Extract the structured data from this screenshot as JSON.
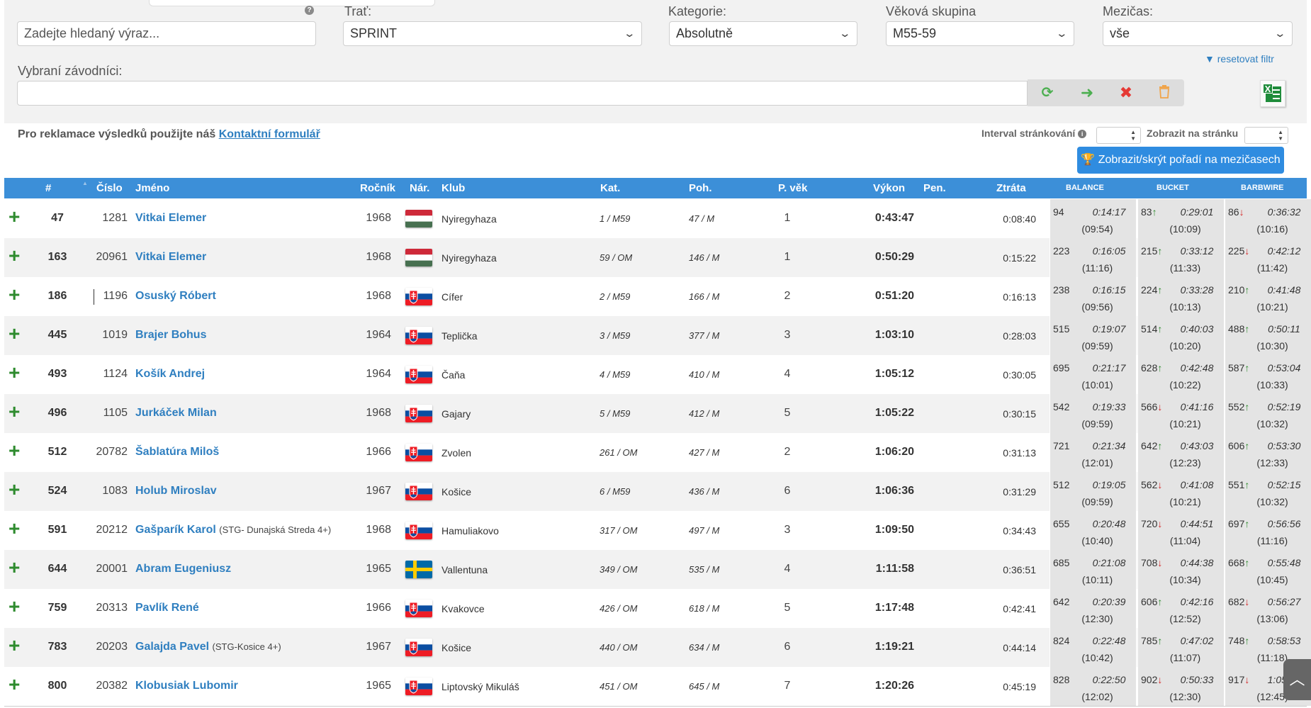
{
  "filters": {
    "search_placeholder": "Zadejte hledaný výraz...",
    "trat": {
      "label": "Trať:",
      "value": "SPRINT"
    },
    "kategorie": {
      "label": "Kategorie:",
      "value": "Absolutně"
    },
    "vekova": {
      "label": "Věková skupina",
      "value": "M55-59"
    },
    "mezicas": {
      "label": "Mezičas:",
      "value": "vše"
    },
    "reset": "resetovat filtr",
    "selected_label": "Vybraní závodníci:"
  },
  "info": {
    "text": "Pro reklamace výsledků použijte náš",
    "link": "Kontaktní formulář",
    "interval": "Interval stránkování",
    "per_page": "Zobrazit na stránku",
    "toggle_button": "Zobrazit/skrýt pořadí na mezičasech"
  },
  "headers": {
    "rank": "#",
    "num": "Číslo",
    "name": "Jméno",
    "year": "Ročník",
    "nat": "Nár.",
    "club": "Klub",
    "kat": "Kat.",
    "poh": "Poh.",
    "pvek": "P. věk",
    "vykon": "Výkon",
    "pen": "Pen.",
    "ztrata": "Ztráta",
    "s1": "BALANCE",
    "s2": "BUCKET",
    "s3": "BARBWIRE"
  },
  "colors": {
    "header_bg": "#3c8fd8",
    "link": "#2f7fc0",
    "up": "#2e8b2e",
    "down": "#d42a2a"
  },
  "rows": [
    {
      "rank": "47",
      "num": "1281",
      "name": "Vitkai Elemer",
      "team": "",
      "year": "1968",
      "flag": "hu",
      "club": "Nyiregyhaza",
      "kat": "1 / M59",
      "poh": "47 / M",
      "pvek": "1",
      "vykon": "0:43:47",
      "ztrata": "0:08:40",
      "s": [
        {
          "r": "94",
          "d": "",
          "t": "0:14:17",
          "sub": "(09:54)"
        },
        {
          "r": "83",
          "d": "up",
          "t": "0:29:01",
          "sub": "(10:09)"
        },
        {
          "r": "86",
          "d": "down",
          "t": "0:36:32",
          "sub": "(10:16)"
        }
      ]
    },
    {
      "rank": "163",
      "num": "20961",
      "name": "Vitkai Elemer",
      "team": "",
      "year": "1968",
      "flag": "hu",
      "club": "Nyiregyhaza",
      "kat": "59 / OM",
      "poh": "146 / M",
      "pvek": "1",
      "vykon": "0:50:29",
      "ztrata": "0:15:22",
      "s": [
        {
          "r": "223",
          "d": "",
          "t": "0:16:05",
          "sub": "(11:16)"
        },
        {
          "r": "215",
          "d": "up",
          "t": "0:33:12",
          "sub": "(11:33)"
        },
        {
          "r": "225",
          "d": "down",
          "t": "0:42:12",
          "sub": "(11:42)"
        }
      ]
    },
    {
      "rank": "186",
      "num": "1196",
      "name": "Osuský Róbert",
      "team": "",
      "year": "1968",
      "flag": "sk",
      "club": "Cífer",
      "kat": "2 / M59",
      "poh": "166 / M",
      "pvek": "2",
      "vykon": "0:51:20",
      "ztrata": "0:16:13",
      "s": [
        {
          "r": "238",
          "d": "",
          "t": "0:16:15",
          "sub": "(09:56)"
        },
        {
          "r": "224",
          "d": "up",
          "t": "0:33:28",
          "sub": "(10:13)"
        },
        {
          "r": "210",
          "d": "up",
          "t": "0:41:48",
          "sub": "(10:21)"
        }
      ]
    },
    {
      "rank": "445",
      "num": "1019",
      "name": "Brajer Bohus",
      "team": "",
      "year": "1964",
      "flag": "sk",
      "club": "Teplička",
      "kat": "3 / M59",
      "poh": "377 / M",
      "pvek": "3",
      "vykon": "1:03:10",
      "ztrata": "0:28:03",
      "s": [
        {
          "r": "515",
          "d": "",
          "t": "0:19:07",
          "sub": "(09:59)"
        },
        {
          "r": "514",
          "d": "up",
          "t": "0:40:03",
          "sub": "(10:20)"
        },
        {
          "r": "488",
          "d": "up",
          "t": "0:50:11",
          "sub": "(10:30)"
        }
      ]
    },
    {
      "rank": "493",
      "num": "1124",
      "name": "Košík Andrej",
      "team": "",
      "year": "1964",
      "flag": "sk",
      "club": "Čaňa",
      "kat": "4 / M59",
      "poh": "410 / M",
      "pvek": "4",
      "vykon": "1:05:12",
      "ztrata": "0:30:05",
      "s": [
        {
          "r": "695",
          "d": "",
          "t": "0:21:17",
          "sub": "(10:01)"
        },
        {
          "r": "628",
          "d": "up",
          "t": "0:42:48",
          "sub": "(10:22)"
        },
        {
          "r": "587",
          "d": "up",
          "t": "0:53:04",
          "sub": "(10:33)"
        }
      ]
    },
    {
      "rank": "496",
      "num": "1105",
      "name": "Jurkáček Milan",
      "team": "",
      "year": "1968",
      "flag": "sk",
      "club": "Gajary",
      "kat": "5 / M59",
      "poh": "412 / M",
      "pvek": "5",
      "vykon": "1:05:22",
      "ztrata": "0:30:15",
      "s": [
        {
          "r": "542",
          "d": "",
          "t": "0:19:33",
          "sub": "(09:59)"
        },
        {
          "r": "566",
          "d": "down",
          "t": "0:41:16",
          "sub": "(10:21)"
        },
        {
          "r": "552",
          "d": "up",
          "t": "0:52:19",
          "sub": "(10:32)"
        }
      ]
    },
    {
      "rank": "512",
      "num": "20782",
      "name": "Šablatúra Miloš",
      "team": "",
      "year": "1966",
      "flag": "sk",
      "club": "Zvolen",
      "kat": "261 / OM",
      "poh": "427 / M",
      "pvek": "2",
      "vykon": "1:06:20",
      "ztrata": "0:31:13",
      "s": [
        {
          "r": "721",
          "d": "",
          "t": "0:21:34",
          "sub": "(12:01)"
        },
        {
          "r": "642",
          "d": "up",
          "t": "0:43:03",
          "sub": "(12:23)"
        },
        {
          "r": "606",
          "d": "up",
          "t": "0:53:30",
          "sub": "(12:33)"
        }
      ]
    },
    {
      "rank": "524",
      "num": "1083",
      "name": "Holub Miroslav",
      "team": "",
      "year": "1967",
      "flag": "sk",
      "club": "Košice",
      "kat": "6 / M59",
      "poh": "436 / M",
      "pvek": "6",
      "vykon": "1:06:36",
      "ztrata": "0:31:29",
      "s": [
        {
          "r": "512",
          "d": "",
          "t": "0:19:05",
          "sub": "(09:59)"
        },
        {
          "r": "562",
          "d": "down",
          "t": "0:41:08",
          "sub": "(10:21)"
        },
        {
          "r": "551",
          "d": "up",
          "t": "0:52:15",
          "sub": "(10:32)"
        }
      ]
    },
    {
      "rank": "591",
      "num": "20212",
      "name": "Gašparík Karol",
      "team": "(STG- Dunajská Streda 4+)",
      "year": "1968",
      "flag": "sk",
      "club": "Hamuliakovo",
      "kat": "317 / OM",
      "poh": "497 / M",
      "pvek": "3",
      "vykon": "1:09:50",
      "ztrata": "0:34:43",
      "s": [
        {
          "r": "655",
          "d": "",
          "t": "0:20:48",
          "sub": "(10:40)"
        },
        {
          "r": "720",
          "d": "down",
          "t": "0:44:51",
          "sub": "(11:04)"
        },
        {
          "r": "697",
          "d": "up",
          "t": "0:56:56",
          "sub": "(11:16)"
        }
      ]
    },
    {
      "rank": "644",
      "num": "20001",
      "name": "Abram Eugeniusz",
      "team": "",
      "year": "1965",
      "flag": "se",
      "club": "Vallentuna",
      "kat": "349 / OM",
      "poh": "535 / M",
      "pvek": "4",
      "vykon": "1:11:58",
      "ztrata": "0:36:51",
      "s": [
        {
          "r": "685",
          "d": "",
          "t": "0:21:08",
          "sub": "(10:11)"
        },
        {
          "r": "708",
          "d": "down",
          "t": "0:44:38",
          "sub": "(10:34)"
        },
        {
          "r": "668",
          "d": "up",
          "t": "0:55:48",
          "sub": "(10:45)"
        }
      ]
    },
    {
      "rank": "759",
      "num": "20313",
      "name": "Pavlík René",
      "team": "",
      "year": "1966",
      "flag": "sk",
      "club": "Kvakovce",
      "kat": "426 / OM",
      "poh": "618 / M",
      "pvek": "5",
      "vykon": "1:17:48",
      "ztrata": "0:42:41",
      "s": [
        {
          "r": "642",
          "d": "",
          "t": "0:20:39",
          "sub": "(12:30)"
        },
        {
          "r": "606",
          "d": "up",
          "t": "0:42:16",
          "sub": "(12:52)"
        },
        {
          "r": "682",
          "d": "down",
          "t": "0:56:27",
          "sub": "(13:06)"
        }
      ]
    },
    {
      "rank": "783",
      "num": "20203",
      "name": "Galajda Pavel",
      "team": "(STG-Kosice 4+)",
      "year": "1967",
      "flag": "sk",
      "club": "Košice",
      "kat": "440 / OM",
      "poh": "634 / M",
      "pvek": "6",
      "vykon": "1:19:21",
      "ztrata": "0:44:14",
      "s": [
        {
          "r": "824",
          "d": "",
          "t": "0:22:48",
          "sub": "(10:42)"
        },
        {
          "r": "785",
          "d": "up",
          "t": "0:47:02",
          "sub": "(11:07)"
        },
        {
          "r": "748",
          "d": "up",
          "t": "0:58:53",
          "sub": "(11:18)"
        }
      ]
    },
    {
      "rank": "800",
      "num": "20382",
      "name": "Klobusiak Lubomir",
      "team": "",
      "year": "1965",
      "flag": "sk",
      "club": "Liptovský Mikuláš",
      "kat": "451 / OM",
      "poh": "645 / M",
      "pvek": "7",
      "vykon": "1:20:26",
      "ztrata": "0:45:19",
      "s": [
        {
          "r": "828",
          "d": "",
          "t": "0:22:50",
          "sub": "(12:02)"
        },
        {
          "r": "902",
          "d": "down",
          "t": "0:50:33",
          "sub": "(12:30)"
        },
        {
          "r": "917",
          "d": "down",
          "t": "1:05:29",
          "sub": "(12:45)"
        }
      ]
    }
  ]
}
